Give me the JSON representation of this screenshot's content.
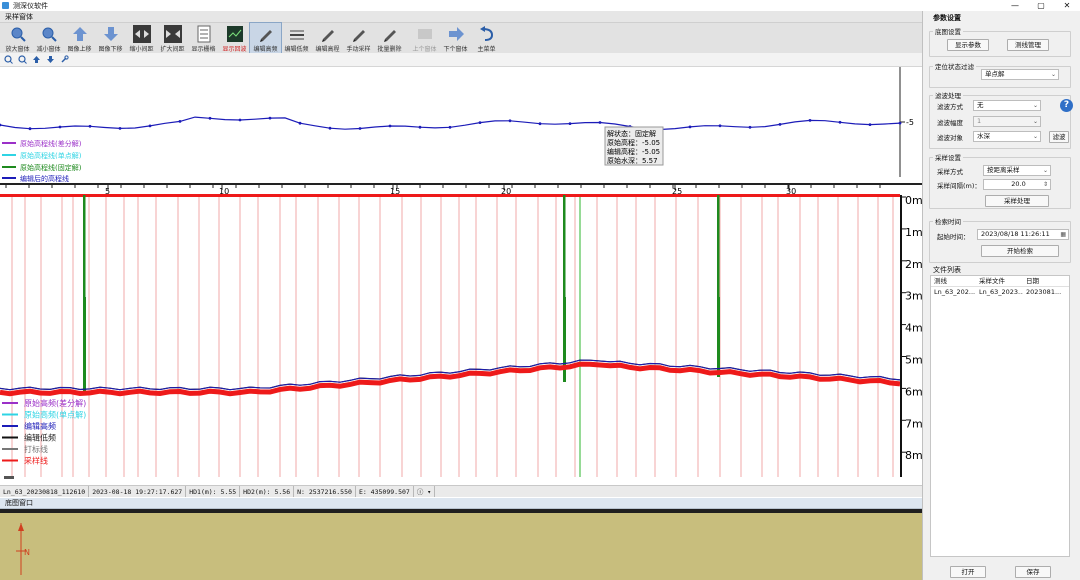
{
  "window": {
    "title": "测深仪软件",
    "controls": [
      "—",
      "▢",
      "✕"
    ]
  },
  "pane": {
    "title": "采样窗体"
  },
  "toolbar": [
    {
      "label": "放大窗体",
      "icon": "zoom-in-icon",
      "state": "normal"
    },
    {
      "label": "减小窗体",
      "icon": "zoom-out-icon",
      "state": "normal"
    },
    {
      "label": "图像上移",
      "icon": "arrow-up-icon",
      "state": "normal"
    },
    {
      "label": "图像下移",
      "icon": "arrow-down-icon",
      "state": "normal"
    },
    {
      "label": "缩小间距",
      "icon": "shrink-icon",
      "state": "normal"
    },
    {
      "label": "扩大间距",
      "icon": "expand-icon",
      "state": "normal"
    },
    {
      "label": "显示栅格",
      "icon": "grid-icon",
      "state": "normal"
    },
    {
      "label": "显示回波",
      "icon": "echo-icon",
      "state": "red"
    },
    {
      "label": "编辑高频",
      "icon": "pencil-icon",
      "state": "active"
    },
    {
      "label": "编辑低频",
      "icon": "edit-low-icon",
      "state": "normal"
    },
    {
      "label": "编辑高程",
      "icon": "pencil-icon",
      "state": "normal"
    },
    {
      "label": "手动采样",
      "icon": "pencil-icon",
      "state": "normal"
    },
    {
      "label": "批量删除",
      "icon": "pencil-icon",
      "state": "normal"
    },
    {
      "label": "上个窗体",
      "icon": "prev-icon",
      "state": "disabled"
    },
    {
      "label": "下个窗体",
      "icon": "next-icon",
      "state": "normal"
    },
    {
      "label": "主菜单",
      "icon": "undo-icon",
      "state": "normal"
    }
  ],
  "upper_plot": {
    "y_tick_label": "-5",
    "legend": [
      {
        "label": "原始高程线(差分解)",
        "color": "#9b30c8"
      },
      {
        "label": "原始高程线(单点解)",
        "color": "#2fd4e4"
      },
      {
        "label": "原始高程线(固定解)",
        "color": "#1e8a1e"
      },
      {
        "label": "编辑后的高程线",
        "color": "#1c1cb8"
      }
    ],
    "tooltip": [
      "解状态：固定解",
      "原始高程：-5.05",
      "编辑高程：-5.05",
      "原始水深：5.57"
    ]
  },
  "sonar": {
    "x_ticks": [
      "5",
      "10",
      "15",
      "20",
      "25",
      "30"
    ],
    "depth_labels": [
      "0m",
      "1m",
      "2m",
      "3m",
      "4m",
      "5m",
      "6m",
      "7m",
      "8m"
    ],
    "legend": [
      {
        "label": "原始高频(差分解)",
        "color": "#9b30c8"
      },
      {
        "label": "原始高频(单点解)",
        "color": "#2fd4e4"
      },
      {
        "label": "编辑高频",
        "color": "#1c1cb8"
      },
      {
        "label": "编辑低频",
        "color": "#111111"
      },
      {
        "label": "打标线",
        "color": "#777777"
      },
      {
        "label": "采样线",
        "color": "#ee1a1a"
      }
    ]
  },
  "status_bar": {
    "file": "Ln_63_20230818_112610",
    "time": "2023-08-18 19:27:17.627",
    "hd1": "HD1(m): 5.55",
    "hd2": "HD2(m): 5.56",
    "north": "N: 2537216.550",
    "east": "E: 435099.507",
    "info": "ⓘ ▾"
  },
  "bottom_window": {
    "title": "底图窗口",
    "north_label": "N"
  },
  "panel": {
    "title": "参数设置",
    "basemap": {
      "title": "底图设置",
      "show_params": "显示参数",
      "line_manage": "测线管理"
    },
    "filter_state": {
      "title": "定位状态过滤",
      "value": "单点解"
    },
    "filter": {
      "title": "滤波处理",
      "method_label": "滤波方式",
      "method_value": "无",
      "size_label": "滤波幅度",
      "size_value": "1",
      "target_label": "滤波对象",
      "target_value": "水深",
      "apply_button": "滤波",
      "help": "?"
    },
    "sampling": {
      "title": "采样设置",
      "method_label": "采样方式",
      "method_value": "按距离采样",
      "interval_label": "采样间隔(m)：",
      "interval_value": "20.0",
      "process_button": "采样处理"
    },
    "retrieval": {
      "title": "检索时间",
      "start_label": "起始时间：",
      "start_value": "2023/08/18 11:26:11",
      "start_button": "开始检索"
    },
    "files": {
      "title": "文件列表",
      "headers": [
        "测线",
        "采样文件",
        "日期"
      ],
      "rows": [
        [
          "Ln_63_202...",
          "Ln_63_2023...",
          "2023081..."
        ]
      ]
    },
    "open_button": "打开",
    "save_button": "保存"
  }
}
